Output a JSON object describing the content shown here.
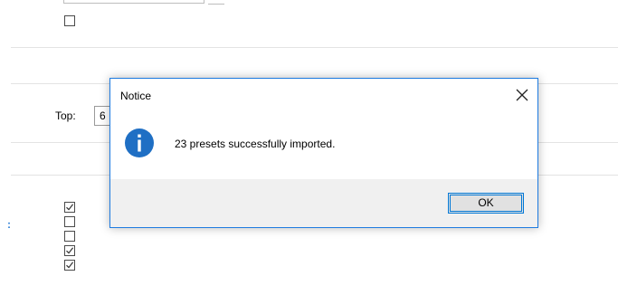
{
  "background": {
    "top_label": "Top:",
    "top_value": "6",
    "side_glyph": ":",
    "first_checkbox_checked": false,
    "checkboxes": [
      true,
      false,
      false,
      true,
      true
    ]
  },
  "dialog": {
    "title": "Notice",
    "icon": "info-icon",
    "message": "23 presets successfully imported.",
    "ok_label": "OK"
  }
}
